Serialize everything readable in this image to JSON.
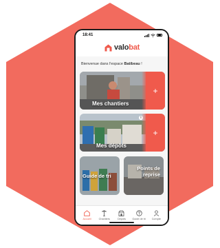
{
  "status_bar": {
    "time": "18:41"
  },
  "header": {
    "logo_prefix": "valo",
    "logo_accent": "bat",
    "logo_icon": "house-icon"
  },
  "welcome": {
    "text": "Bienvenue dans l'espace ",
    "name": "Batibeau",
    "suffix": " !"
  },
  "cards": {
    "chantiers": {
      "label": "Mes chantiers",
      "action": "+"
    },
    "depots": {
      "label": "Mes dépôts",
      "action": "+"
    },
    "guide": {
      "label": "Guide de tri"
    },
    "points": {
      "label": "Points de reprise"
    }
  },
  "tabs": [
    {
      "label": "Accueil",
      "icon": "home-icon",
      "active": true
    },
    {
      "label": "Chantiers",
      "icon": "crane-icon"
    },
    {
      "label": "Dépôts",
      "icon": "depot-icon"
    },
    {
      "label": "Guide de tri",
      "icon": "help-icon"
    },
    {
      "label": "Compte",
      "icon": "user-icon"
    }
  ],
  "colors": {
    "accent": "#f05a4c",
    "hexagon": "#f26b5e"
  }
}
